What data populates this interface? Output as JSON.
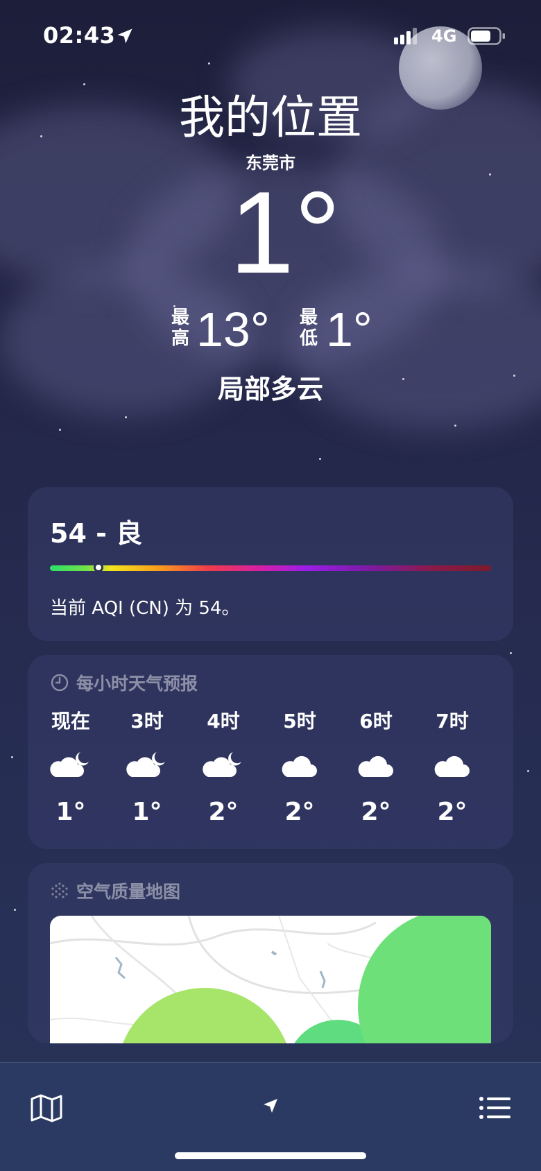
{
  "status_bar": {
    "time": "02:43",
    "network": "4G"
  },
  "hero": {
    "location_title": "我的位置",
    "city": "东莞市",
    "current_temp": "1°",
    "high_label": "最高",
    "high_value": "13°",
    "low_label": "最低",
    "low_value": "1°",
    "condition": "局部多云"
  },
  "aqi": {
    "title": "54 - 良",
    "value": 54,
    "level_fraction": 0.11,
    "description": "当前 AQI (CN) 为 54。"
  },
  "hourly": {
    "header": "每小时天气预报",
    "items": [
      {
        "hour": "现在",
        "icon": "cloud-moon-icon",
        "temp": "1°"
      },
      {
        "hour": "3时",
        "icon": "cloud-moon-icon",
        "temp": "1°"
      },
      {
        "hour": "4时",
        "icon": "cloud-moon-icon",
        "temp": "2°"
      },
      {
        "hour": "5时",
        "icon": "cloud-icon",
        "temp": "2°"
      },
      {
        "hour": "6时",
        "icon": "cloud-icon",
        "temp": "2°"
      },
      {
        "hour": "7时",
        "icon": "cloud-icon",
        "temp": "2°"
      }
    ]
  },
  "air_map": {
    "header": "空气质量地图"
  },
  "tabbar": {
    "left_icon": "map-icon",
    "center_icon": "location-arrow-icon",
    "right_icon": "list-icon"
  },
  "colors": {
    "aqi_good": "#6ee07a",
    "aqi_moderate": "#a6e46a",
    "tabbar_bg": "#2b3a62"
  }
}
